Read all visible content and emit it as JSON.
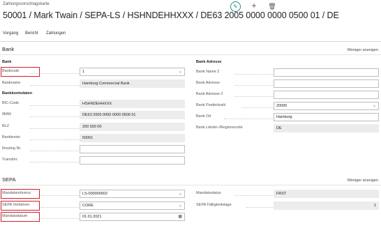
{
  "header": {
    "page_kind": "Zahlungsvorschlagskarte",
    "title": "50001 / Mark Twain / SEPA-LS / HSHNDEHHXXX / DE63 2005 0000 0000 0500 01 / DE",
    "icons": {
      "edit": "pencil-icon",
      "add": "plus-icon",
      "delete": "trash-icon"
    }
  },
  "actions": [
    "Vorgang",
    "Bericht",
    "Zahlungen"
  ],
  "bank": {
    "title": "Bank",
    "show_less": "Weniger anzeigen",
    "left_group": "Bank",
    "bankcode_label": "Bankcode",
    "bankcode_value": "1",
    "bankname_label": "Bankname",
    "bankname_value": "Hamburg Commercial Bank",
    "kontodaten_group": "Bankkontodaten",
    "bic_label": "BIC-Code",
    "bic_value": "HSHNDEHHXXX",
    "iban_label": "IBAN",
    "iban_value": "DE63 2005 0000 0000 0500 01",
    "blz_label": "BLZ",
    "blz_value": "200 500 00",
    "konto_label": "Bankkonto",
    "konto_value": "50001",
    "routing_label": "Routing Nr.",
    "routing_value": "",
    "transit_label": "Transitnr.",
    "transit_value": "",
    "right_group": "Bank Adresse",
    "name2_label": "Bank Name 2",
    "name2_value": "",
    "adresse_label": "Bank Adresse",
    "adresse_value": "",
    "adresse2_label": "Bank Adresse 2",
    "adresse2_value": "",
    "plz_label": "Bank Postleitzahl",
    "plz_value": "20095",
    "ort_label": "Bank Ort",
    "ort_value": "Hamburg",
    "land_label": "Bank Länder-/Regionscode",
    "land_value": "DE"
  },
  "sepa": {
    "title": "SEPA",
    "show_less": "Weniger anzeigen",
    "mandatsref_label": "Mandatsreferenz",
    "mandatsref_value": "LS-000000002",
    "verfahren_label": "SEPA Verfahren",
    "verfahren_value": "CORE",
    "datum_label": "Mandatsdatum",
    "datum_value": "01.01.2021",
    "status_label": "Mandatsstatus",
    "status_value": "FRST",
    "faellig_label": "SEPA Fälligkeitstage",
    "faellig_value": "1"
  },
  "colors": {
    "accent": "#2a8c84",
    "highlight": "#d21f2b"
  }
}
